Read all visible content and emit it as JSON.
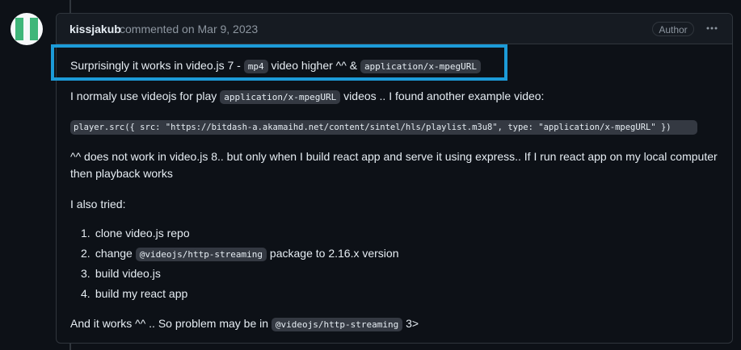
{
  "comment": {
    "author": "kissjakub",
    "meta": "commented on Mar 9, 2023",
    "badge": "Author",
    "more_icon": "kebab-horizontal-icon"
  },
  "lines": {
    "l1": {
      "a": "Surprisingly it works in video.js 7 - ",
      "code1": "mp4",
      "b": " video higher ^^ & ",
      "code2": "application/x-mpegURL"
    },
    "l2": {
      "a": "I normaly use videojs for play ",
      "code": "application/x-mpegURL",
      "b": " videos .. I found another example video:"
    },
    "code_block": "player.src({ src: \"https://bitdash-a.akamaihd.net/content/sintel/hls/playlist.m3u8\", type: \"application/x-mpegURL\" })",
    "l3_line1": "^^ does not work in video.js 8.. but only when I build react app and serve it using express.. If I run react app on my local computer",
    "l3_line2": "then playback works",
    "l4": "I also tried:",
    "list": [
      {
        "num": "1.",
        "a": "clone video.js repo"
      },
      {
        "num": "2.",
        "a": "change ",
        "code": "@videojs/http-streaming",
        "b": " package to 2.16.x version"
      },
      {
        "num": "3.",
        "a": "build video.js"
      },
      {
        "num": "4.",
        "a": "build my react app"
      }
    ],
    "l5": {
      "a": "And it works ^^ .. So problem may be in ",
      "code": "@videojs/http-streaming",
      "b": " 3>"
    }
  },
  "colors": {
    "highlight_border": "#1c9bd8",
    "avatar_green": "#3fb67a"
  }
}
